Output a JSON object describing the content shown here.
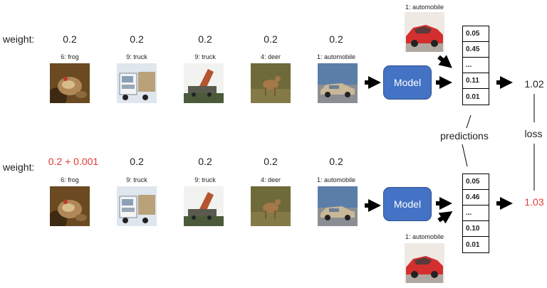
{
  "rows": [
    {
      "weight_label": "weight:",
      "weights": [
        "0.2",
        "0.2",
        "0.2",
        "0.2",
        "0.2"
      ],
      "images": [
        {
          "label": "6: frog",
          "icon": "frog-thumbnail"
        },
        {
          "label": "9: truck",
          "icon": "truck-thumbnail"
        },
        {
          "label": "9: truck",
          "icon": "crane-truck-thumbnail"
        },
        {
          "label": "4: deer",
          "icon": "deer-thumbnail"
        },
        {
          "label": "1: automobile",
          "icon": "sedan-thumbnail"
        }
      ],
      "model_label": "Model",
      "extra_image": {
        "label": "1: automobile",
        "icon": "red-car-thumbnail"
      },
      "predictions": [
        "0.05",
        "0.45",
        "...",
        "0.11",
        "0.01"
      ],
      "loss": "1.02"
    },
    {
      "weight_label": "weight:",
      "weights": [
        "0.2 + 0.001",
        "0.2",
        "0.2",
        "0.2",
        "0.2"
      ],
      "images": [
        {
          "label": "6: frog",
          "icon": "frog-thumbnail"
        },
        {
          "label": "9: truck",
          "icon": "truck-thumbnail"
        },
        {
          "label": "9: truck",
          "icon": "crane-truck-thumbnail"
        },
        {
          "label": "4: deer",
          "icon": "deer-thumbnail"
        },
        {
          "label": "1: automobile",
          "icon": "sedan-thumbnail"
        }
      ],
      "model_label": "Model",
      "extra_image": {
        "label": "1: automobile",
        "icon": "red-car-thumbnail"
      },
      "predictions": [
        "0.05",
        "0.46",
        "...",
        "0.10",
        "0.01"
      ],
      "loss": "1.03"
    }
  ],
  "predictions_label": "predictions",
  "loss_label": "loss",
  "colors": {
    "highlight": "#e53935",
    "model_fill": "#4472c4",
    "arrow": "#000000"
  }
}
